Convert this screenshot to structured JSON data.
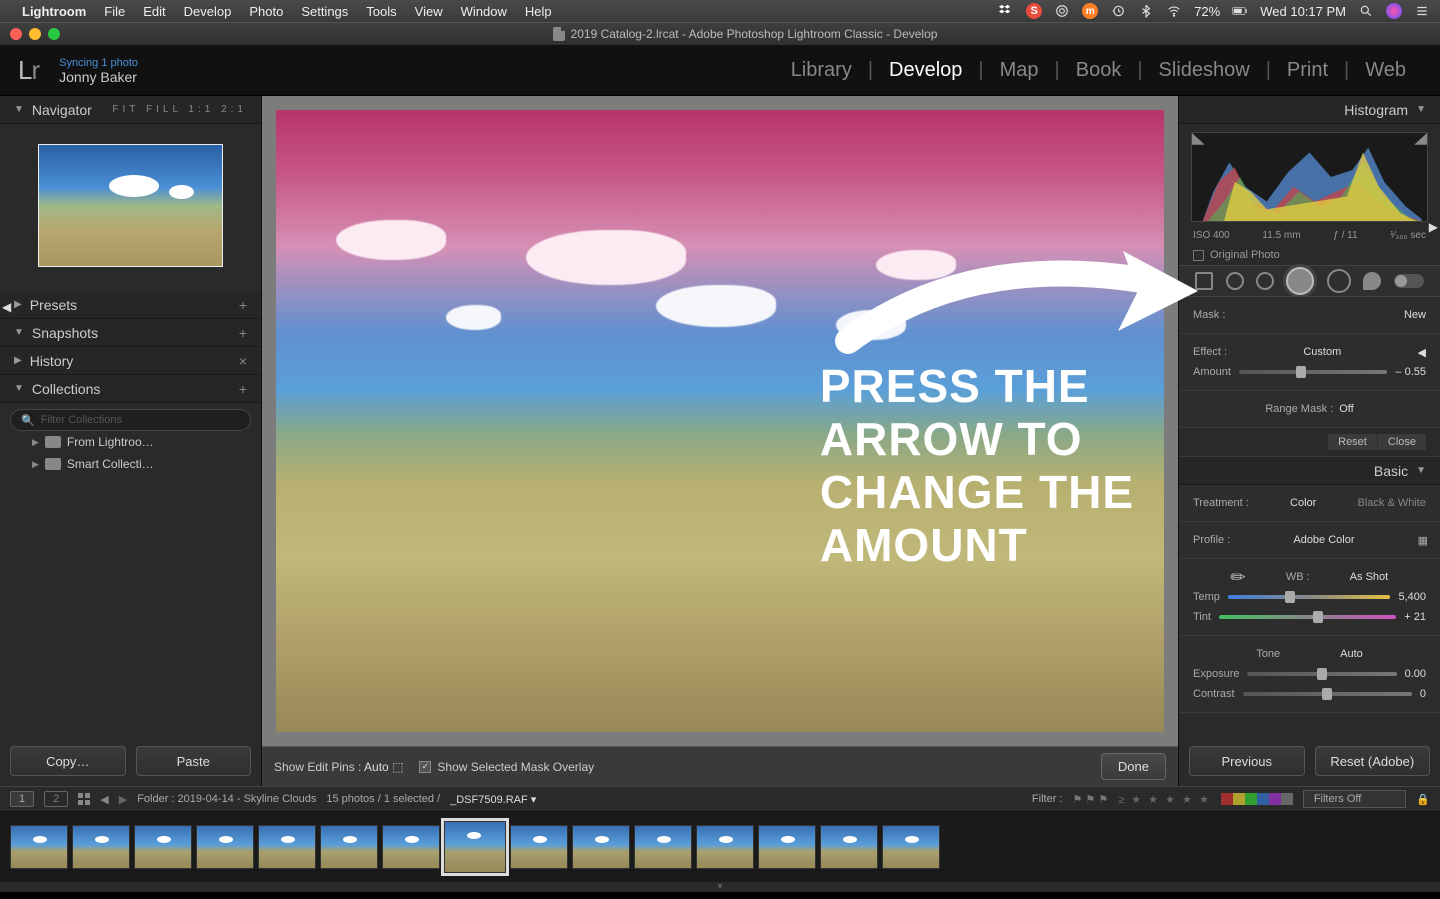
{
  "menubar": {
    "app": "Lightroom",
    "items": [
      "File",
      "Edit",
      "Develop",
      "Photo",
      "Settings",
      "Tools",
      "View",
      "Window",
      "Help"
    ],
    "battery": "72%",
    "clock": "Wed 10:17 PM"
  },
  "titlebar": {
    "title": "2019 Catalog-2.lrcat - Adobe Photoshop Lightroom Classic - Develop"
  },
  "identity": {
    "sync": "Syncing 1 photo",
    "name": "Jonny Baker"
  },
  "modules": [
    "Library",
    "Develop",
    "Map",
    "Book",
    "Slideshow",
    "Print",
    "Web"
  ],
  "active_module": "Develop",
  "left": {
    "navigator": {
      "title": "Navigator",
      "modes": "FIT   FILL   1:1   2:1"
    },
    "presets": {
      "title": "Presets"
    },
    "snapshots": {
      "title": "Snapshots"
    },
    "history": {
      "title": "History"
    },
    "collections": {
      "title": "Collections",
      "filter_placeholder": "Filter Collections",
      "items": [
        "From Lightroo…",
        "Smart Collecti…"
      ]
    },
    "copy": "Copy…",
    "paste": "Paste"
  },
  "overlay": {
    "line1": "PRESS THE",
    "line2": "ARROW TO",
    "line3": "CHANGE THE",
    "line4": "AMOUNT"
  },
  "center_toolbar": {
    "pins_label": "Show Edit Pins :",
    "pins_value": "Auto",
    "mask_label": "Show Selected Mask Overlay",
    "done": "Done"
  },
  "right": {
    "histogram": {
      "title": "Histogram",
      "iso": "ISO 400",
      "focal": "11.5 mm",
      "aperture": "ƒ / 11",
      "shutter": "¹⁄₃₀₀ sec"
    },
    "original": "Original Photo",
    "mask": {
      "label": "Mask :",
      "value": "New"
    },
    "effect": {
      "label": "Effect :",
      "value": "Custom",
      "amount_label": "Amount",
      "amount": "– 0.55"
    },
    "rangemask": {
      "label": "Range Mask :",
      "value": "Off"
    },
    "reset": "Reset",
    "close": "Close",
    "basic": {
      "title": "Basic",
      "treatment": "Treatment :",
      "color": "Color",
      "bw": "Black & White",
      "profile_label": "Profile :",
      "profile": "Adobe Color",
      "wb_label": "WB :",
      "wb": "As Shot",
      "temp_label": "Temp",
      "temp": "5,400",
      "tint_label": "Tint",
      "tint": "+ 21",
      "tone": "Tone",
      "auto": "Auto",
      "exposure_label": "Exposure",
      "exposure": "0.00",
      "contrast_label": "Contrast",
      "contrast": "0"
    },
    "previous": "Previous",
    "reset_btn": "Reset (Adobe)"
  },
  "filmstrip_bar": {
    "path": "Folder : 2019-04-14 - Skyline Clouds",
    "count": "15 photos / 1 selected /",
    "filename": "_DSF7509.RAF",
    "filter_label": "Filter :",
    "filters_off": "Filters Off"
  }
}
